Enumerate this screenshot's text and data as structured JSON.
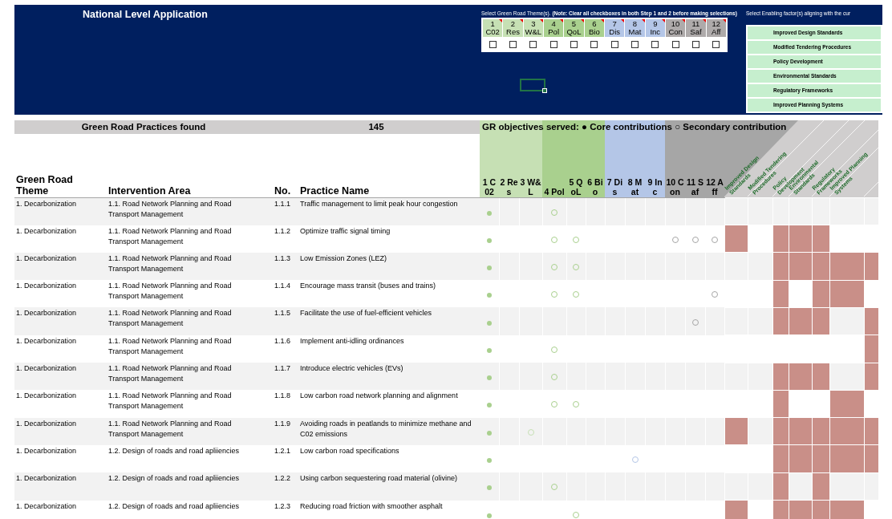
{
  "title": "National Level Application",
  "step1": {
    "instruction": "Select Green Road Theme(s). **(Note: Clear all checkboxes in both Step 1 and 2 before making selections)**",
    "themes": [
      {
        "number": "1",
        "abbr": "C02",
        "color": "#c6e0b4",
        "checked": false
      },
      {
        "number": "2",
        "abbr": "Res",
        "color": "#c6e0b4",
        "checked": false
      },
      {
        "number": "3",
        "abbr": "W&L",
        "color": "#c6e0b4",
        "checked": false
      },
      {
        "number": "4",
        "abbr": "Pol",
        "color": "#a9d08e",
        "checked": false
      },
      {
        "number": "5",
        "abbr": "QoL",
        "color": "#a9d08e",
        "checked": false
      },
      {
        "number": "6",
        "abbr": "Bio",
        "color": "#a9d08e",
        "checked": false
      },
      {
        "number": "7",
        "abbr": "Dis",
        "color": "#b4c6e7",
        "checked": false
      },
      {
        "number": "8",
        "abbr": "Mat",
        "color": "#b4c6e7",
        "checked": false
      },
      {
        "number": "9",
        "abbr": "Inc",
        "color": "#b4c6e7",
        "checked": false
      },
      {
        "number": "10",
        "abbr": "Con",
        "color": "#aeaaaa",
        "checked": false
      },
      {
        "number": "11",
        "abbr": "Saf",
        "color": "#aeaaaa",
        "checked": false
      },
      {
        "number": "12",
        "abbr": "Aff",
        "color": "#aeaaaa",
        "checked": false
      }
    ]
  },
  "step2": {
    "instruction": "Select Enabling factor(s) aligning with the cur",
    "factors": [
      {
        "label": "Improved Design Standards"
      },
      {
        "label": "Modified Tendering Procedures"
      },
      {
        "label": "Policy Development"
      },
      {
        "label": "Environmental Standards"
      },
      {
        "label": "Regulatory Frameworks"
      },
      {
        "label": "Improved Planning Systems"
      }
    ]
  },
  "summary": {
    "label": "Green Road Practices found",
    "count": "145"
  },
  "legend": "GR objectives served: ● Core contributions ○ Secondary contribution",
  "columns": [
    "Green Road Theme",
    "Intervention Area",
    "No.",
    "Practice Name"
  ],
  "objective_columns": [
    {
      "label": "1 C02",
      "color": "#c6e0b4"
    },
    {
      "label": "2 Res",
      "color": "#c6e0b4"
    },
    {
      "label": "3 W&L",
      "color": "#c6e0b4"
    },
    {
      "label": "4 Pol",
      "color": "#a9d08e"
    },
    {
      "label": "5 QoL",
      "color": "#a9d08e"
    },
    {
      "label": "6 Bio",
      "color": "#a9d08e"
    },
    {
      "label": "7 Dis",
      "color": "#b4c6e7"
    },
    {
      "label": "8 Mat",
      "color": "#b4c6e7"
    },
    {
      "label": "9 Inc",
      "color": "#b4c6e7"
    },
    {
      "label": "10 Con",
      "color": "#a6a6a6"
    },
    {
      "label": "11 Saf",
      "color": "#a6a6a6"
    },
    {
      "label": "12 Aff",
      "color": "#a6a6a6"
    }
  ],
  "factor_columns": [
    {
      "label": "Improved Design Standards"
    },
    {
      "label": "Modified Tendering Procedures"
    },
    {
      "label": "Policy Development"
    },
    {
      "label": "Environmental Standards"
    },
    {
      "label": "Regulatory Frameworks"
    },
    {
      "label": "Improved Planning Systems"
    }
  ],
  "rows": [
    {
      "theme": "1. Decarbonization",
      "area": "1.1. Road Network Planning and Road Transport Management",
      "no": "1.1.1",
      "practice": "Traffic management to limit peak hour congestion",
      "objectives": [
        {
          "kind": "core"
        },
        {
          "kind": "blank"
        },
        {
          "kind": "blank"
        },
        {
          "kind": "secondary"
        },
        {
          "kind": "blank"
        },
        {
          "kind": "blank"
        },
        {
          "kind": "blank"
        },
        {
          "kind": "blank"
        },
        {
          "kind": "blank"
        },
        {
          "kind": "blank"
        },
        {
          "kind": "blank"
        },
        {
          "kind": "blank"
        }
      ],
      "enablers": [
        false,
        false,
        false,
        false,
        false,
        false,
        false
      ]
    },
    {
      "theme": "1. Decarbonization",
      "area": "1.1. Road Network Planning and Road Transport Management",
      "no": "1.1.2",
      "practice": "Optimize traffic signal timing",
      "objectives": [
        {
          "kind": "core"
        },
        {
          "kind": "blank"
        },
        {
          "kind": "blank"
        },
        {
          "kind": "secondary"
        },
        {
          "kind": "secondary"
        },
        {
          "kind": "blank"
        },
        {
          "kind": "blank"
        },
        {
          "kind": "blank"
        },
        {
          "kind": "blank"
        },
        {
          "kind": "secondary"
        },
        {
          "kind": "secondary"
        },
        {
          "kind": "secondary"
        }
      ],
      "enablers": [
        true,
        false,
        true,
        true,
        true,
        false,
        false
      ]
    },
    {
      "theme": "1. Decarbonization",
      "area": "1.1. Road Network Planning and Road Transport Management",
      "no": "1.1.3",
      "practice": "Low Emission Zones (LEZ)",
      "objectives": [
        {
          "kind": "core"
        },
        {
          "kind": "blank"
        },
        {
          "kind": "blank"
        },
        {
          "kind": "secondary"
        },
        {
          "kind": "secondary"
        },
        {
          "kind": "blank"
        },
        {
          "kind": "blank"
        },
        {
          "kind": "blank"
        },
        {
          "kind": "blank"
        },
        {
          "kind": "blank"
        },
        {
          "kind": "blank"
        },
        {
          "kind": "blank"
        }
      ],
      "enablers": [
        false,
        false,
        true,
        true,
        true,
        true,
        true
      ]
    },
    {
      "theme": "1. Decarbonization",
      "area": "1.1. Road Network Planning and Road Transport Management",
      "no": "1.1.4",
      "practice": "Encourage mass transit (buses and trains)",
      "objectives": [
        {
          "kind": "core"
        },
        {
          "kind": "blank"
        },
        {
          "kind": "blank"
        },
        {
          "kind": "secondary"
        },
        {
          "kind": "secondary"
        },
        {
          "kind": "blank"
        },
        {
          "kind": "blank"
        },
        {
          "kind": "blank"
        },
        {
          "kind": "blank"
        },
        {
          "kind": "blank"
        },
        {
          "kind": "blank"
        },
        {
          "kind": "secondary"
        }
      ],
      "enablers": [
        false,
        false,
        true,
        false,
        true,
        true,
        false
      ]
    },
    {
      "theme": "1. Decarbonization",
      "area": "1.1. Road Network Planning and Road Transport Management",
      "no": "1.1.5",
      "practice": "Facilitate the use of fuel-efficient vehicles",
      "objectives": [
        {
          "kind": "core"
        },
        {
          "kind": "blank"
        },
        {
          "kind": "blank"
        },
        {
          "kind": "blank"
        },
        {
          "kind": "blank"
        },
        {
          "kind": "blank"
        },
        {
          "kind": "blank"
        },
        {
          "kind": "blank"
        },
        {
          "kind": "blank"
        },
        {
          "kind": "blank"
        },
        {
          "kind": "secondary"
        },
        {
          "kind": "blank"
        }
      ],
      "enablers": [
        false,
        false,
        true,
        true,
        true,
        false,
        true
      ]
    },
    {
      "theme": "1. Decarbonization",
      "area": "1.1. Road Network Planning and Road Transport Management",
      "no": "1.1.6",
      "practice": "Implement anti-idling ordinances",
      "objectives": [
        {
          "kind": "core"
        },
        {
          "kind": "blank"
        },
        {
          "kind": "blank"
        },
        {
          "kind": "secondary"
        },
        {
          "kind": "blank"
        },
        {
          "kind": "blank"
        },
        {
          "kind": "blank"
        },
        {
          "kind": "blank"
        },
        {
          "kind": "blank"
        },
        {
          "kind": "blank"
        },
        {
          "kind": "blank"
        },
        {
          "kind": "blank"
        }
      ],
      "enablers": [
        false,
        false,
        false,
        false,
        false,
        false,
        true
      ]
    },
    {
      "theme": "1. Decarbonization",
      "area": "1.1. Road Network Planning and Road Transport Management",
      "no": "1.1.7",
      "practice": "Introduce electric vehicles (EVs)",
      "objectives": [
        {
          "kind": "core"
        },
        {
          "kind": "blank"
        },
        {
          "kind": "blank"
        },
        {
          "kind": "secondary"
        },
        {
          "kind": "blank"
        },
        {
          "kind": "blank"
        },
        {
          "kind": "blank"
        },
        {
          "kind": "blank"
        },
        {
          "kind": "blank"
        },
        {
          "kind": "blank"
        },
        {
          "kind": "blank"
        },
        {
          "kind": "blank"
        }
      ],
      "enablers": [
        false,
        false,
        true,
        true,
        true,
        false,
        true
      ]
    },
    {
      "theme": "1. Decarbonization",
      "area": "1.1. Road Network Planning and Road Transport Management",
      "no": "1.1.8",
      "practice": "Low carbon road network planning and alignment",
      "objectives": [
        {
          "kind": "core"
        },
        {
          "kind": "blank"
        },
        {
          "kind": "blank"
        },
        {
          "kind": "secondary"
        },
        {
          "kind": "secondary"
        },
        {
          "kind": "blank"
        },
        {
          "kind": "blank"
        },
        {
          "kind": "blank"
        },
        {
          "kind": "blank"
        },
        {
          "kind": "blank"
        },
        {
          "kind": "blank"
        },
        {
          "kind": "blank"
        }
      ],
      "enablers": [
        false,
        false,
        true,
        false,
        false,
        true,
        false
      ]
    },
    {
      "theme": "1. Decarbonization",
      "area": "1.1. Road Network Planning and Road Transport Management",
      "no": "1.1.9",
      "practice": "Avoiding roads in peatlands to minimize methane and C02 emissions",
      "objectives": [
        {
          "kind": "core"
        },
        {
          "kind": "blank"
        },
        {
          "kind": "secondary"
        },
        {
          "kind": "blank"
        },
        {
          "kind": "blank"
        },
        {
          "kind": "blank"
        },
        {
          "kind": "blank"
        },
        {
          "kind": "blank"
        },
        {
          "kind": "blank"
        },
        {
          "kind": "blank"
        },
        {
          "kind": "blank"
        },
        {
          "kind": "blank"
        }
      ],
      "enablers": [
        true,
        false,
        true,
        true,
        true,
        true,
        true
      ]
    },
    {
      "theme": "1. Decarbonization",
      "area": "1.2. Design of roads and road apliiencies",
      "no": "1.2.1",
      "practice": "Low carbon road specifications",
      "objectives": [
        {
          "kind": "core"
        },
        {
          "kind": "blank"
        },
        {
          "kind": "blank"
        },
        {
          "kind": "blank"
        },
        {
          "kind": "blank"
        },
        {
          "kind": "blank"
        },
        {
          "kind": "blank"
        },
        {
          "kind": "secondary"
        },
        {
          "kind": "blank"
        },
        {
          "kind": "blank"
        },
        {
          "kind": "blank"
        },
        {
          "kind": "blank"
        }
      ],
      "enablers": [
        false,
        false,
        true,
        true,
        true,
        true,
        true
      ]
    },
    {
      "theme": "1. Decarbonization",
      "area": "1.2. Design of roads and road apliiencies",
      "no": "1.2.2",
      "practice": "Using carbon sequestering road material (olivine)",
      "objectives": [
        {
          "kind": "core"
        },
        {
          "kind": "blank"
        },
        {
          "kind": "blank"
        },
        {
          "kind": "secondary"
        },
        {
          "kind": "blank"
        },
        {
          "kind": "blank"
        },
        {
          "kind": "blank"
        },
        {
          "kind": "blank"
        },
        {
          "kind": "blank"
        },
        {
          "kind": "blank"
        },
        {
          "kind": "blank"
        },
        {
          "kind": "blank"
        }
      ],
      "enablers": [
        false,
        false,
        true,
        false,
        true,
        false,
        false
      ]
    },
    {
      "theme": "1. Decarbonization",
      "area": "1.2. Design of roads and road apliiencies",
      "no": "1.2.3",
      "practice": "Reducing road friction with smoother asphalt",
      "objectives": [
        {
          "kind": "core"
        },
        {
          "kind": "blank"
        },
        {
          "kind": "blank"
        },
        {
          "kind": "blank"
        },
        {
          "kind": "secondary"
        },
        {
          "kind": "blank"
        },
        {
          "kind": "blank"
        },
        {
          "kind": "blank"
        },
        {
          "kind": "blank"
        },
        {
          "kind": "blank"
        },
        {
          "kind": "blank"
        },
        {
          "kind": "blank"
        }
      ],
      "enablers": [
        true,
        false,
        true,
        true,
        true,
        true,
        false
      ]
    }
  ]
}
